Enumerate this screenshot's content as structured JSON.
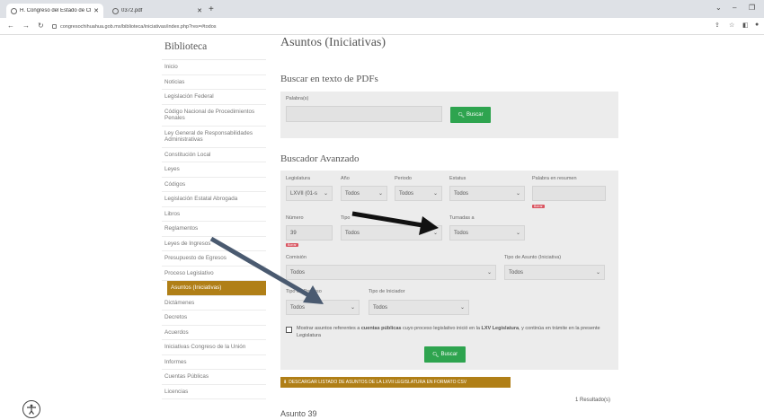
{
  "browser": {
    "tab1_title": "H. Congreso del Estado de Chih",
    "tab2_title": "0372.pdf",
    "url": "congresochihuahua.gob.mx/biblioteca/iniciativas/index.php?res=#todos"
  },
  "sidebar": {
    "title": "Biblioteca",
    "items": [
      {
        "label": "Inicio"
      },
      {
        "label": "Noticias"
      },
      {
        "label": "Legislación Federal"
      },
      {
        "label": "Código Nacional de Procedimientos Penales"
      },
      {
        "label": "Ley General de Responsabilidades Administrativas"
      },
      {
        "label": "Constitución Local"
      },
      {
        "label": "Leyes"
      },
      {
        "label": "Códigos"
      },
      {
        "label": "Legislación Estatal Abrogada"
      },
      {
        "label": "Libros"
      },
      {
        "label": "Reglamentos"
      },
      {
        "label": "Leyes de Ingresos"
      },
      {
        "label": "Presupuesto de Egresos"
      },
      {
        "label": "Proceso Legislativo"
      },
      {
        "label": "Asuntos (Iniciativas)",
        "active": true
      },
      {
        "label": "Dictámenes"
      },
      {
        "label": "Decretos"
      },
      {
        "label": "Acuerdos"
      },
      {
        "label": "Iniciativas Congreso de la Unión"
      },
      {
        "label": "Informes"
      },
      {
        "label": "Cuentas Públicas"
      },
      {
        "label": "Licencias"
      }
    ]
  },
  "main": {
    "title": "Asuntos (Iniciativas)",
    "pdf_search": {
      "heading": "Buscar en texto de PDFs",
      "label": "Palabra(s)",
      "value": "",
      "button": "Buscar"
    },
    "advanced": {
      "heading": "Buscador Avanzado",
      "legislatura_label": "Legislatura",
      "legislatura_value": "LXVII (01-s",
      "anio_label": "Año",
      "anio_value": "Todos",
      "periodo_label": "Periodo",
      "periodo_value": "Todos",
      "estatus_label": "Estatus",
      "estatus_value": "Todos",
      "palabra_label": "Palabra en resumen",
      "palabra_value": "",
      "borrar_label": "Borrar",
      "numero_label": "Número",
      "numero_value": "39",
      "tipo_label": "Tipo",
      "tipo_value": "Todos",
      "turnadas_label": "Turnadas a",
      "turnadas_value": "Todos",
      "comision_label": "Comisión",
      "comision_value": "Todos",
      "tipo_asunto_label": "Tipo de Asunto (Iniciativa)",
      "tipo_asunto_value": "Todos",
      "tipo_proceso_label": "Tipo de Proceso",
      "tipo_proceso_value": "Todos",
      "tipo_iniciador_label": "Tipo de Iniciador",
      "tipo_iniciador_value": "Todos",
      "checkbox_text_1": "Mostrar asuntos referentes a",
      "checkbox_text_bold1": "cuentas públicas",
      "checkbox_text_2": "cuyo proceso legislativo inició en la",
      "checkbox_text_bold2": "LXV Legislatura",
      "checkbox_text_3": ", y continúa en trámite en la presente Legislatura",
      "button": "Buscar"
    },
    "csv_button": "DESCARGAR LISTADO DE ASUNTOS DE LA LXVII LEGISLATURA EN FORMATO CSV",
    "result_count": "1 Resultado(s)",
    "result_title": "Asunto 39"
  },
  "colors": {
    "accent_gold": "#b07f17",
    "button_green": "#2ea44f",
    "badge_red": "#d9535f",
    "arrow": "#000000"
  }
}
